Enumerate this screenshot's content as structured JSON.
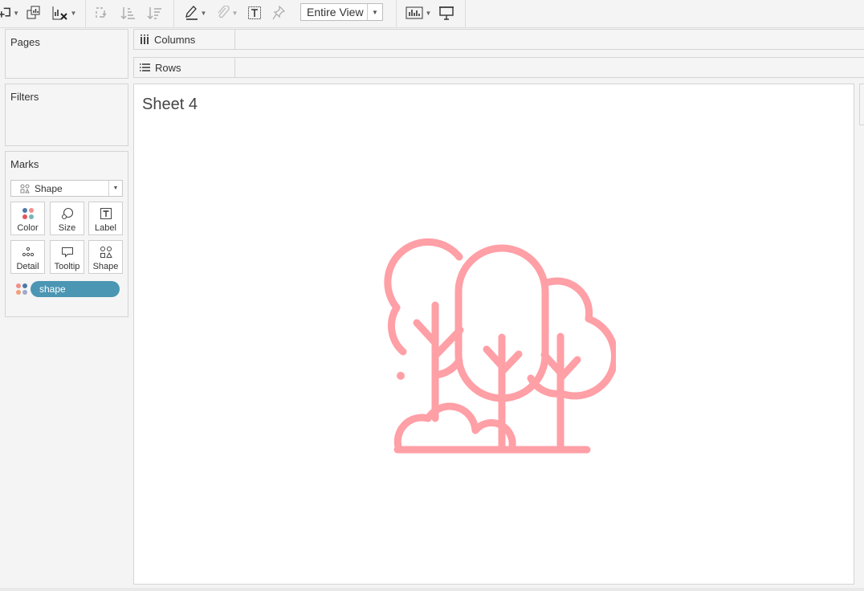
{
  "toolbar": {
    "fit_dropdown_value": "Entire View",
    "icons": [
      "new-worksheet-icon",
      "duplicate-sheet-icon",
      "clear-sheet-icon",
      "swap-rows-columns-icon",
      "sort-ascending-icon",
      "sort-descending-icon",
      "highlight-icon",
      "group-members-icon",
      "show-mark-labels-icon",
      "pin-axes-icon",
      "show-me-icon",
      "presentation-mode-icon"
    ]
  },
  "panels": {
    "pages_title": "Pages",
    "filters_title": "Filters",
    "marks_title": "Marks"
  },
  "shelves": {
    "columns_label": "Columns",
    "rows_label": "Rows"
  },
  "marks": {
    "mark_type": "Shape",
    "buttons": {
      "color": "Color",
      "size": "Size",
      "label": "Label",
      "detail": "Detail",
      "tooltip": "Tooltip",
      "shape": "Shape"
    },
    "pill_label": "shape",
    "pill_color": "#4a96b3"
  },
  "sheet": {
    "title": "Sheet 4",
    "shape_icon": "trees-icon",
    "shape_color": "#ff9fa6"
  }
}
